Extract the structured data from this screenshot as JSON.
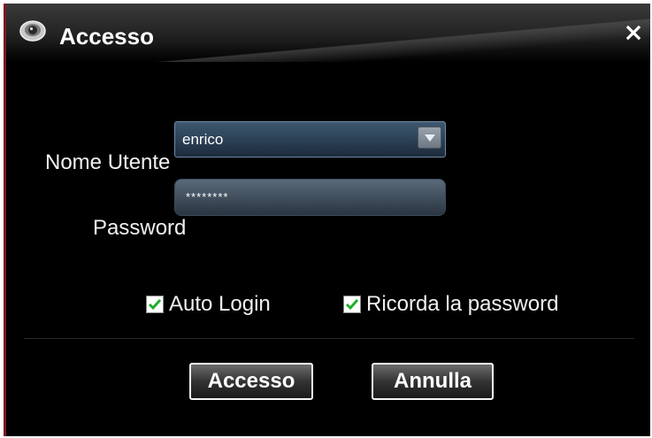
{
  "window": {
    "title": "Accesso",
    "close_label": "✕"
  },
  "form": {
    "username_label": "Nome Utente",
    "username_value": "enrico",
    "password_label": "Password",
    "password_value": "********"
  },
  "options": {
    "auto_login": {
      "label": "Auto Login",
      "checked": true
    },
    "remember_password": {
      "label": "Ricorda la password",
      "checked": true
    }
  },
  "buttons": {
    "login_label": "Accesso",
    "cancel_label": "Annulla"
  },
  "colors": {
    "background": "#000000",
    "checkmark": "#1fae2a",
    "frame_accent": "#7a1a22"
  }
}
